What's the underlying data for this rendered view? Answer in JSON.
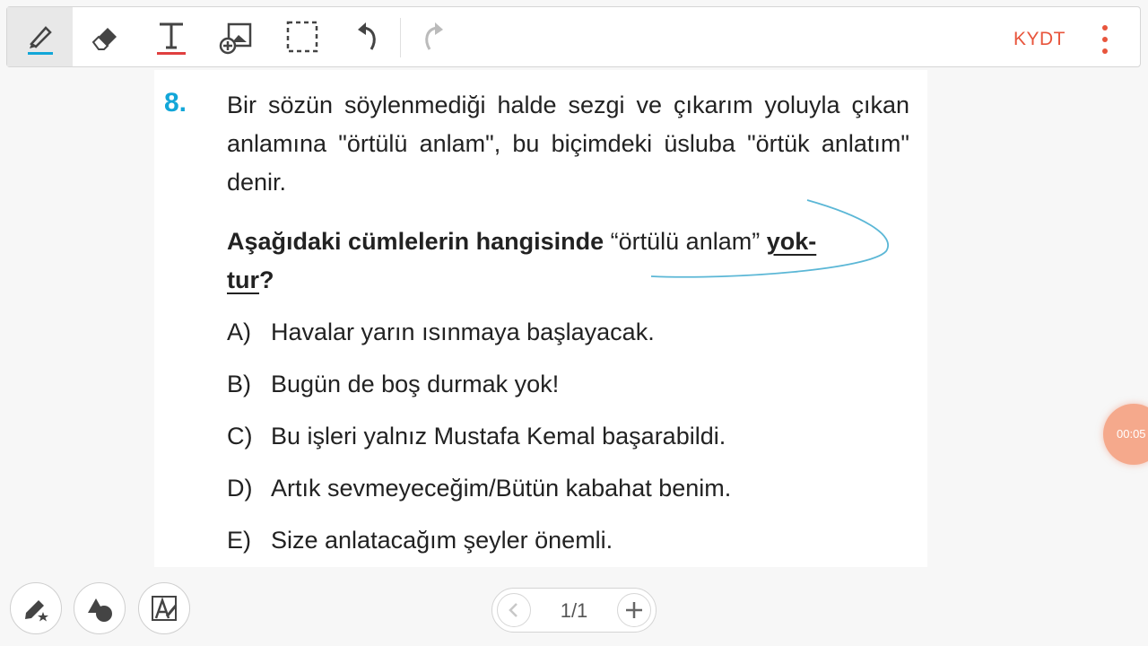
{
  "toolbar": {
    "tools": [
      {
        "name": "pen-icon",
        "active": true
      },
      {
        "name": "eraser-icon"
      },
      {
        "name": "text-icon"
      },
      {
        "name": "add-image-icon"
      },
      {
        "name": "selection-icon"
      },
      {
        "name": "undo-icon"
      },
      {
        "name": "redo-icon",
        "disabled": true
      }
    ],
    "brand_label": "KYDT",
    "accent_color": "#e8553c",
    "pen_color": "#12a6d8"
  },
  "document": {
    "question_number": "8.",
    "paragraph": "Bir sözün söylenmediği halde sezgi ve çıkarım yoluyla çıkan anlamına \"örtülü anlam\", bu biçimdeki üsluba \"örtük anlatım\" denir.",
    "question": {
      "part1": "Aşağıdaki cümlelerin hangisinde",
      "quoted": "“örtülü anlam”",
      "part2": "yok-",
      "part3": "tur",
      "qmark": "?"
    },
    "options": [
      {
        "letter": "A)",
        "text": "Havalar yarın ısınmaya başlayacak."
      },
      {
        "letter": "B)",
        "text": "Bugün de boş durmak yok!"
      },
      {
        "letter": "C)",
        "text": "Bu işleri yalnız Mustafa Kemal başarabildi."
      },
      {
        "letter": "D)",
        "text": "Artık sevmeyeceğim/Bütün kabahat benim."
      },
      {
        "letter": "E)",
        "text": "Size anlatacağım şeyler önemli."
      }
    ]
  },
  "bottom": {
    "buttons": [
      "pen-star-icon",
      "shapes-icon",
      "text-recognition-icon"
    ],
    "page_indicator": "1/1"
  },
  "timer": "00:05"
}
